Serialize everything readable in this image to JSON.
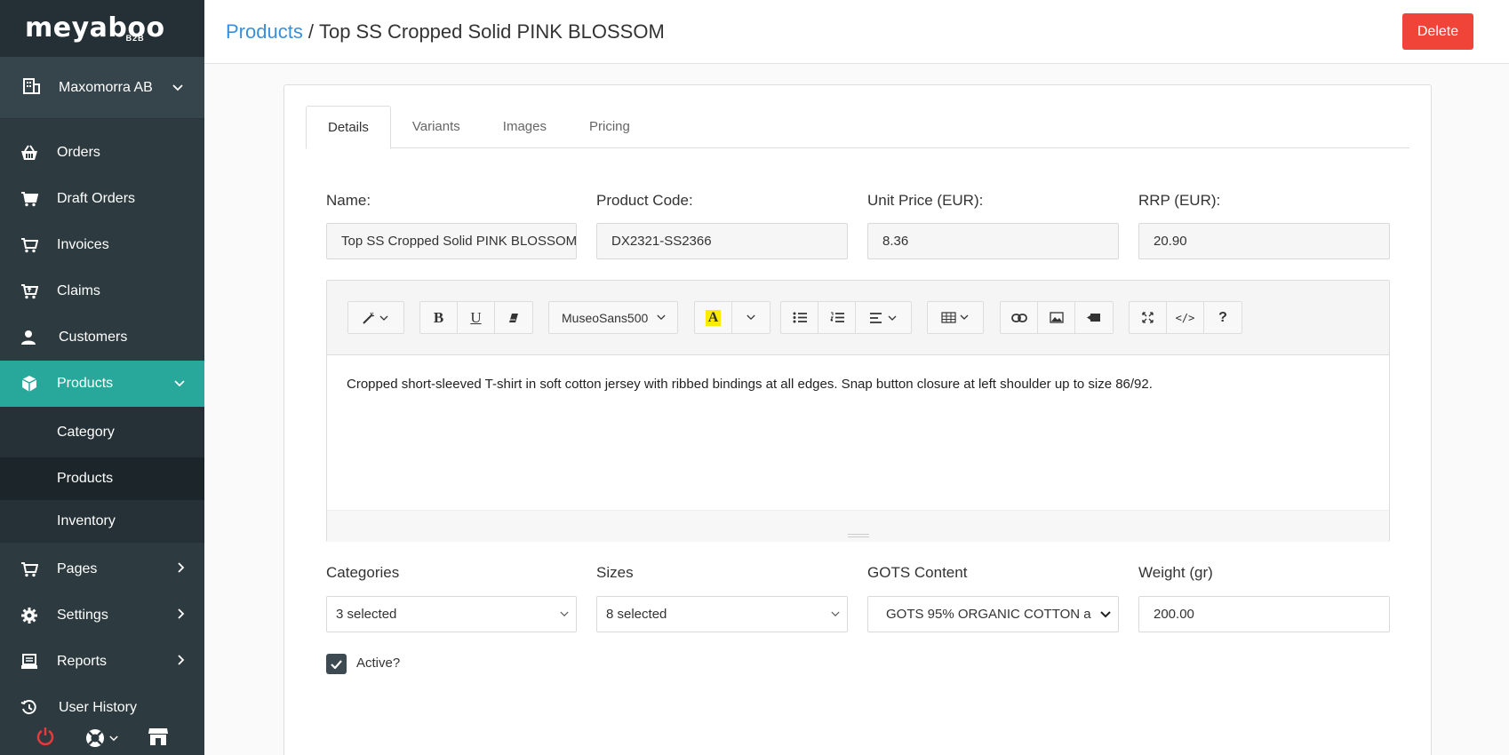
{
  "brand": {
    "name": "meyaboo",
    "sub": "B2B"
  },
  "sidebar": {
    "company": "Maxomorra AB",
    "items": [
      {
        "label": "Orders",
        "icon": "basket-icon"
      },
      {
        "label": "Draft Orders",
        "icon": "cart-icon"
      },
      {
        "label": "Invoices",
        "icon": "cart-icon"
      },
      {
        "label": "Claims",
        "icon": "cart-return-icon"
      },
      {
        "label": "Customers",
        "icon": "user-icon"
      },
      {
        "label": "Products",
        "icon": "box-icon"
      },
      {
        "label": "Pages",
        "icon": "cart-icon"
      },
      {
        "label": "Settings",
        "icon": "gear-icon"
      },
      {
        "label": "Reports",
        "icon": "report-icon"
      },
      {
        "label": "User History",
        "icon": "history-icon"
      }
    ],
    "submenu": [
      "Category",
      "Products",
      "Inventory"
    ]
  },
  "header": {
    "breadcrumb_link": "Products",
    "breadcrumb_sep": "/",
    "title": "Top SS Cropped Solid PINK BLOSSOM",
    "delete_label": "Delete",
    "accent": "#3b8fd9",
    "danger": "#f04438"
  },
  "tabs": [
    "Details",
    "Variants",
    "Images",
    "Pricing"
  ],
  "form": {
    "name_label": "Name:",
    "name_value": "Top SS Cropped Solid PINK BLOSSOM",
    "code_label": "Product Code:",
    "code_value": "DX2321-SS2366",
    "unit_price_label": "Unit Price (EUR):",
    "unit_price_value": "8.36",
    "rrp_label": "RRP (EUR):",
    "rrp_value": "20.90",
    "categories_label": "Categories",
    "categories_value": "3 selected",
    "sizes_label": "Sizes",
    "sizes_value": "8 selected",
    "gots_label": "GOTS Content",
    "gots_value": "GOTS 95% ORGANIC COTTON a",
    "weight_label": "Weight (gr)",
    "weight_value": "200.00",
    "active_label": "Active?",
    "active_checked": true
  },
  "editor": {
    "font_name": "MuseoSans500",
    "description": "Cropped short-sleeved T-shirt in soft cotton jersey with ribbed bindings at all edges. Snap button closure at left shoulder up to size 86/92."
  }
}
